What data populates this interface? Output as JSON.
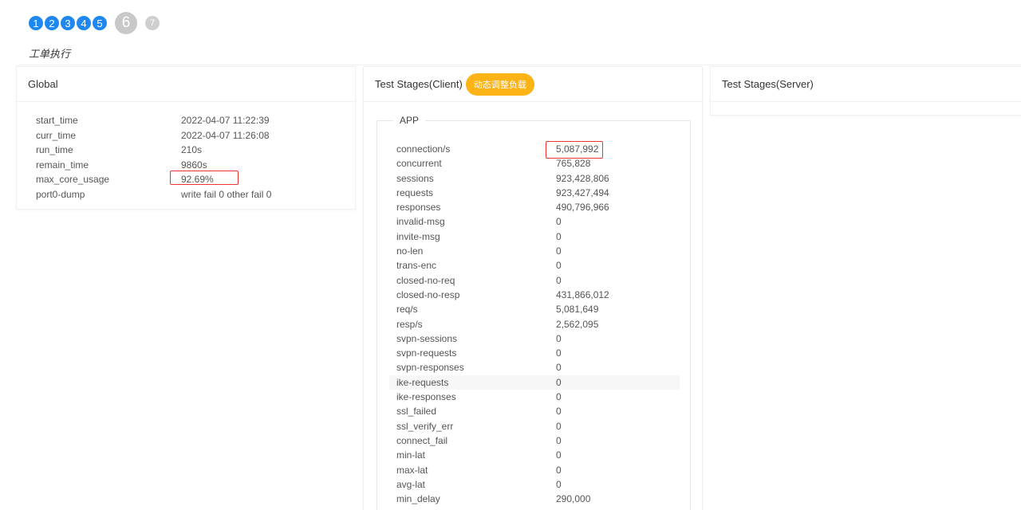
{
  "steps": {
    "done": [
      "1",
      "2",
      "3",
      "4",
      "5"
    ],
    "current": "6",
    "future": "7"
  },
  "page_subtitle": "工单执行",
  "global": {
    "title": "Global",
    "rows": [
      {
        "key": "start_time",
        "value": "2022-04-07 11:22:39"
      },
      {
        "key": "curr_time",
        "value": "2022-04-07 11:26:08"
      },
      {
        "key": "run_time",
        "value": "210s"
      },
      {
        "key": "remain_time",
        "value": "9860s"
      },
      {
        "key": "max_core_usage",
        "value": "92.69%"
      },
      {
        "key": "port0-dump",
        "value": "write fail 0 other fail 0"
      }
    ]
  },
  "client": {
    "title": "Test Stages(Client)",
    "adjust_label": "动态调整负载",
    "app_legend": "APP",
    "rows": [
      {
        "key": "connection/s",
        "value": "5,087,992"
      },
      {
        "key": "concurrent",
        "value": "765,828"
      },
      {
        "key": "sessions",
        "value": "923,428,806"
      },
      {
        "key": "requests",
        "value": "923,427,494"
      },
      {
        "key": "responses",
        "value": "490,796,966"
      },
      {
        "key": "invalid-msg",
        "value": "0"
      },
      {
        "key": "invite-msg",
        "value": "0"
      },
      {
        "key": "no-len",
        "value": "0"
      },
      {
        "key": "trans-enc",
        "value": "0"
      },
      {
        "key": "closed-no-req",
        "value": "0"
      },
      {
        "key": "closed-no-resp",
        "value": "431,866,012"
      },
      {
        "key": "req/s",
        "value": "5,081,649"
      },
      {
        "key": "resp/s",
        "value": "2,562,095"
      },
      {
        "key": "svpn-sessions",
        "value": "0"
      },
      {
        "key": "svpn-requests",
        "value": "0"
      },
      {
        "key": "svpn-responses",
        "value": "0"
      },
      {
        "key": "ike-requests",
        "value": "0"
      },
      {
        "key": "ike-responses",
        "value": "0"
      },
      {
        "key": "ssl_failed",
        "value": "0"
      },
      {
        "key": "ssl_verify_err",
        "value": "0"
      },
      {
        "key": "connect_fail",
        "value": "0"
      },
      {
        "key": "min-lat",
        "value": "0"
      },
      {
        "key": "max-lat",
        "value": "0"
      },
      {
        "key": "avg-lat",
        "value": "0"
      },
      {
        "key": "min_delay",
        "value": "290,000"
      }
    ]
  },
  "server": {
    "title": "Test Stages(Server)"
  },
  "colors": {
    "step_done": "#1e88f0",
    "step_current": "#c8c8c8",
    "adjust_button": "#fcb316",
    "highlight": "#e33333"
  }
}
